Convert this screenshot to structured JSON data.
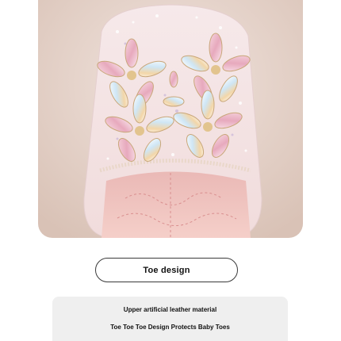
{
  "product_image": {
    "icon": "jeweled-shoe-toe-photo"
  },
  "label": {
    "text": "Toe design"
  },
  "info": {
    "line1": "Upper artificial leather material",
    "line2": "Toe Toe Toe Design Protects Baby Toes"
  },
  "colors": {
    "background": "#ffffff",
    "photo_background": "#e9d8cf",
    "shoe_pink": "#f3d3d0",
    "info_box": "#efefef",
    "text": "#111111"
  }
}
